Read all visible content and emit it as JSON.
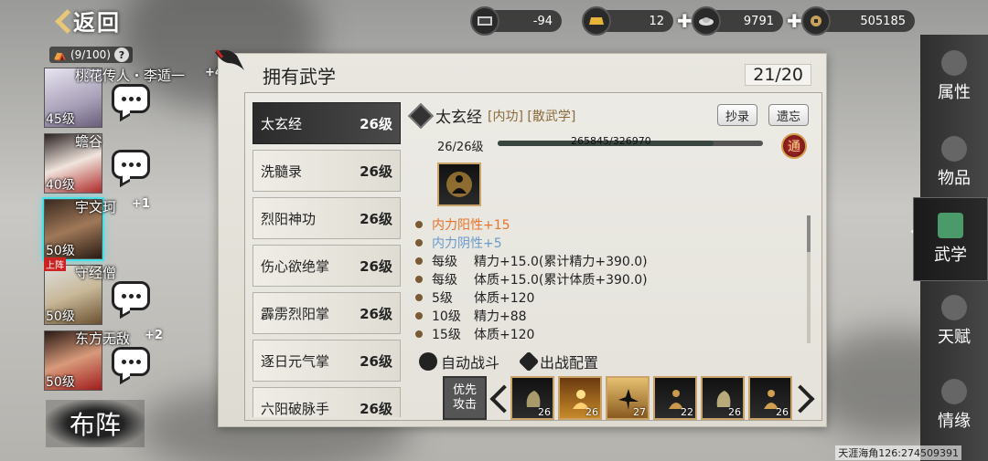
{
  "back": {
    "label": "返回"
  },
  "currencies": [
    {
      "icon": "ration-icon",
      "value": "-94",
      "plus": false
    },
    {
      "icon": "gold-bar-icon",
      "value": "12",
      "plus": true
    },
    {
      "icon": "silver-ingot-icon",
      "value": "9791",
      "plus": true
    },
    {
      "icon": "coin-icon",
      "value": "505185",
      "plus": false
    }
  ],
  "party": {
    "capacity": "(9/100)",
    "help": "?",
    "heroes": [
      {
        "name": "桃花传人・李遁一",
        "plus": "+4",
        "level": "45级"
      },
      {
        "name": "蟾谷",
        "plus": "",
        "level": "40级"
      },
      {
        "name": "宇文珂",
        "plus": "+1",
        "level": "50级"
      },
      {
        "name": "守经僧",
        "plus": "",
        "level": "50级",
        "tag": "上阵"
      },
      {
        "name": "东方无敌",
        "plus": "+2",
        "level": "50级"
      }
    ],
    "formation": "布阵"
  },
  "panel": {
    "title": "拥有武学",
    "count": "21/20"
  },
  "skills": [
    {
      "name": "太玄经",
      "level": "26级"
    },
    {
      "name": "洗髓录",
      "level": "26级"
    },
    {
      "name": "烈阳神功",
      "level": "26级"
    },
    {
      "name": "伤心欲绝掌",
      "level": "26级"
    },
    {
      "name": "霹雳烈阳掌",
      "level": "26级"
    },
    {
      "name": "逐日元气掌",
      "level": "26级"
    },
    {
      "name": "六阳破脉手",
      "level": "26级"
    }
  ],
  "detail": {
    "name": "太玄经",
    "tags": "[内功] [散武学]",
    "copy_btn": "抄录",
    "forget_btn": "遗忘",
    "level_text": "26/26级",
    "exp_text": "265845/326970",
    "exp_fraction": 0.813,
    "tong": "通",
    "attrs": [
      {
        "c1": "内力阳性+15",
        "c2": "",
        "type": "yang"
      },
      {
        "c1": "内力阴性+5",
        "c2": "",
        "type": "yin"
      },
      {
        "c1": "每级",
        "c2": "精力+15.0(累计精力+390.0)",
        "type": ""
      },
      {
        "c1": "每级",
        "c2": "体质+15.0(累计体质+390.0)",
        "type": ""
      },
      {
        "c1": "5级",
        "c2": "体质+120",
        "type": ""
      },
      {
        "c1": "10级",
        "c2": "精力+88",
        "type": ""
      },
      {
        "c1": "15级",
        "c2": "体质+120",
        "type": ""
      }
    ],
    "auto_battle": "自动战斗",
    "battle_config": "出战配置",
    "priority_l1": "优先",
    "priority_l2": "攻击",
    "slots": [
      {
        "level": "26"
      },
      {
        "level": "26"
      },
      {
        "level": "27"
      },
      {
        "level": "22"
      },
      {
        "level": "26"
      },
      {
        "level": "26"
      }
    ]
  },
  "tabs": [
    {
      "label": "属性",
      "icon": "horse-icon"
    },
    {
      "label": "物品",
      "icon": "box-icon"
    },
    {
      "label": "武学",
      "icon": "book-icon"
    },
    {
      "label": "天赋",
      "icon": "branch-icon"
    },
    {
      "label": "情缘",
      "icon": "heart-icon"
    }
  ],
  "footer": "天涯海角126:274509391"
}
